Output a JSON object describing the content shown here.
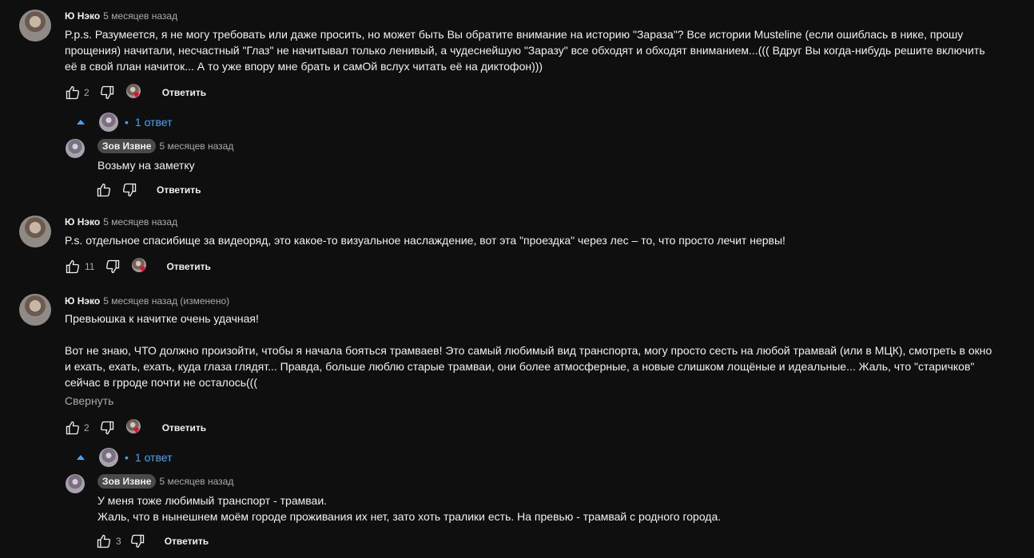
{
  "comments": [
    {
      "author": "Ю Нэко",
      "time": "5 месяцев назад",
      "text": "P.p.s. Разумеется, я не могу требовать или даже просить, но может быть Вы обратите внимание на историю \"Зараза\"? Все истории Musteline (если ошиблась в нике, прошу прощения) начитали, несчастный \"Глаз\" не начитывал только ленивый, а чудеснейшую \"Заразу\" все обходят и обходят вниманием...((( Вдруг Вы когда-нибудь решите включить её в свой план начиток... А то уже впору мне брать и самОй вслух читать её на диктофон)))",
      "likes": "2",
      "reply_label": "Ответить",
      "replies_toggle": "1 ответ"
    },
    {
      "author": "Зов Извне",
      "time": "5 месяцев назад",
      "text": "Возьму на заметку",
      "likes": "",
      "reply_label": "Ответить"
    },
    {
      "author": "Ю Нэко",
      "time": "5 месяцев назад",
      "text": "P.s. отдельное спасибище за видеоряд, это какое-то визуальное наслаждение, вот эта \"проездка\" через лес – то, что просто лечит нервы!",
      "likes": "11",
      "reply_label": "Ответить"
    },
    {
      "author": "Ю Нэко",
      "time": "5 месяцев назад (изменено)",
      "text": "Превьюшка к начитке очень удачная!\n\nВот не знаю, ЧТО должно произойти, чтобы я начала бояться трамваев! Это самый любимый вид транспорта, могу просто сесть на любой трамвай (или в МЦК), смотреть в окно и ехать, ехать, ехать, куда глаза глядят... Правда, больше люблю старые трамваи, они более атмосферные, а новые слишком лощёные и идеальные... Жаль, что \"старичков\" сейчас в грроде почти не осталось(((",
      "collapse_label": "Свернуть",
      "likes": "2",
      "reply_label": "Ответить",
      "replies_toggle": "1 ответ"
    },
    {
      "author": "Зов Извне",
      "time": "5 месяцев назад",
      "text": "У меня тоже любимый транспорт - трамваи.\nЖаль, что в нынешнем моём городе проживания их нет, зато хоть тралики есть. На превью - трамвай с родного города.",
      "likes": "3",
      "reply_label": "Ответить"
    }
  ],
  "icons": {
    "like": "thumb-up-icon",
    "dislike": "thumb-down-icon",
    "creator_heart": "heart-icon",
    "expand": "caret-up-icon"
  },
  "colors": {
    "background": "#0f0f0f",
    "text": "#f1f1f1",
    "secondary": "#aaaaaa",
    "link": "#3ea6ff",
    "heart": "#ff0033",
    "author_chip": "#4a4a4a"
  }
}
